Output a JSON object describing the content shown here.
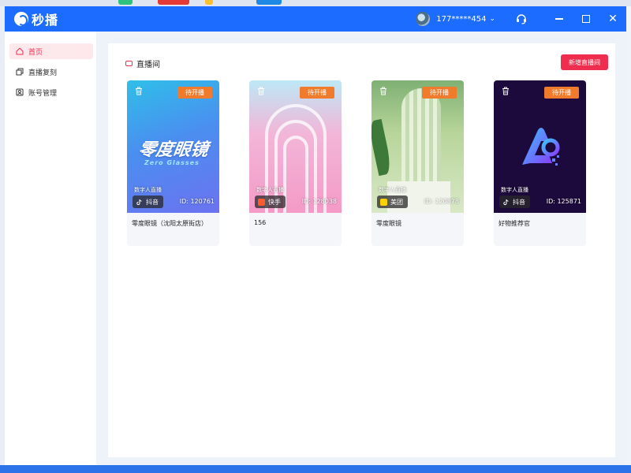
{
  "app": {
    "name": "秒播",
    "brand_color": "#1b6cff",
    "accent_color": "#ef2d4f"
  },
  "titlebar": {
    "user": "177*****454",
    "icons": [
      "avatar",
      "chevron-down-icon",
      "headset-icon",
      "minimize-icon",
      "maximize-icon",
      "close-icon"
    ],
    "close_glyph": "✕"
  },
  "sidebar": {
    "items": [
      {
        "label": "首页",
        "icon": "home-icon",
        "active": true
      },
      {
        "label": "直播复刻",
        "icon": "copy-icon",
        "active": false
      },
      {
        "label": "账号管理",
        "icon": "account-icon",
        "active": false
      }
    ]
  },
  "main": {
    "title": "直播间",
    "new_button": "新增直播间",
    "cards": [
      {
        "status": "待开播",
        "tag": "数字人直播",
        "platform": "抖音",
        "id": "ID: 120761",
        "name": "零度眼镜（沈阳太原街店）",
        "art_text": "零度眼镜",
        "art_sub": "Zero Glasses"
      },
      {
        "status": "待开播",
        "tag": "数字人直播",
        "platform": "快手",
        "id": "ID: 128038",
        "name": "156"
      },
      {
        "status": "待开播",
        "tag": "数字人直播",
        "platform": "美团",
        "id": "ID: 120878",
        "name": "零度眼镜"
      },
      {
        "status": "待开播",
        "tag": "数字人直播",
        "platform": "抖音",
        "id": "ID: 125871",
        "name": "好物推荐官"
      }
    ]
  }
}
